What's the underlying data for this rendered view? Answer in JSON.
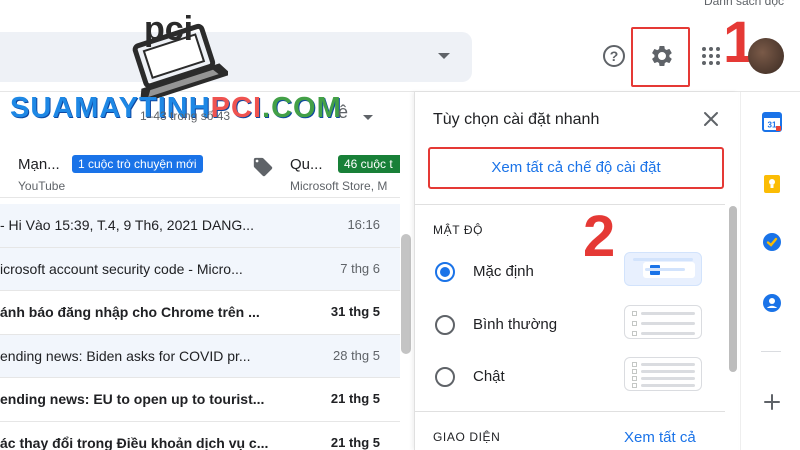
{
  "header": {
    "top_strip_text": "Danh sách đọc",
    "help_icon": "question-circle-icon",
    "settings_icon": "gear-icon",
    "apps_icon": "apps-grid-icon",
    "step_one": "1",
    "accent_red": "#e53935"
  },
  "watermark": {
    "part1": "SUAMAYTINH",
    "part2": "PCI",
    "part3": ".COM",
    "logo_text": "pci"
  },
  "mail_list": {
    "pager_text": "1–43 trong số 43",
    "pager_dropdown_label": "ê",
    "categories": [
      {
        "title": "Mạn...",
        "badge": "1 cuộc trò chuyện mới",
        "badge_color": "#1a73e8",
        "sub": "YouTube"
      },
      {
        "title": "Qu...",
        "badge": "46 cuộc t",
        "badge_color": "#188038",
        "sub": "Microsoft Store, M"
      }
    ],
    "rows": [
      {
        "subject": "- Hi Vào 15:39, T.4, 9 Th6, 2021 DANG...",
        "date": "16:16",
        "state": "read"
      },
      {
        "subject": "icrosoft account security code - Micro...",
        "date": "7 thg 6",
        "state": "read"
      },
      {
        "subject": "ánh báo đăng nhập cho Chrome trên ...",
        "date": "31 thg 5",
        "state": "unread"
      },
      {
        "subject": "ending news: Biden asks for COVID pr...",
        "date": "28 thg 5",
        "state": "read"
      },
      {
        "subject": "ending news: EU to open up to tourist...",
        "date": "21 thg 5",
        "state": "unread"
      },
      {
        "subject": "ác thay đổi trong Điều khoản dịch vụ c...",
        "date": "21 thg 5",
        "state": "unread"
      }
    ]
  },
  "quick_settings": {
    "title": "Tùy chọn cài đặt nhanh",
    "see_all_button": "Xem tất cả chế độ cài đặt",
    "density_heading": "MẬT ĐỘ",
    "step_two": "2",
    "density_options": [
      {
        "label": "Mặc định",
        "selected": true
      },
      {
        "label": "Bình thường",
        "selected": false
      },
      {
        "label": "Chật",
        "selected": false
      }
    ],
    "theme_heading": "GIAO DIỆN",
    "theme_link": "Xem tất cả",
    "accent_blue": "#1a73e8"
  },
  "side_panel": {
    "icons": [
      "calendar-icon",
      "keep-icon",
      "tasks-icon",
      "contacts-icon",
      "add-icon"
    ],
    "calendar_day": "31"
  }
}
